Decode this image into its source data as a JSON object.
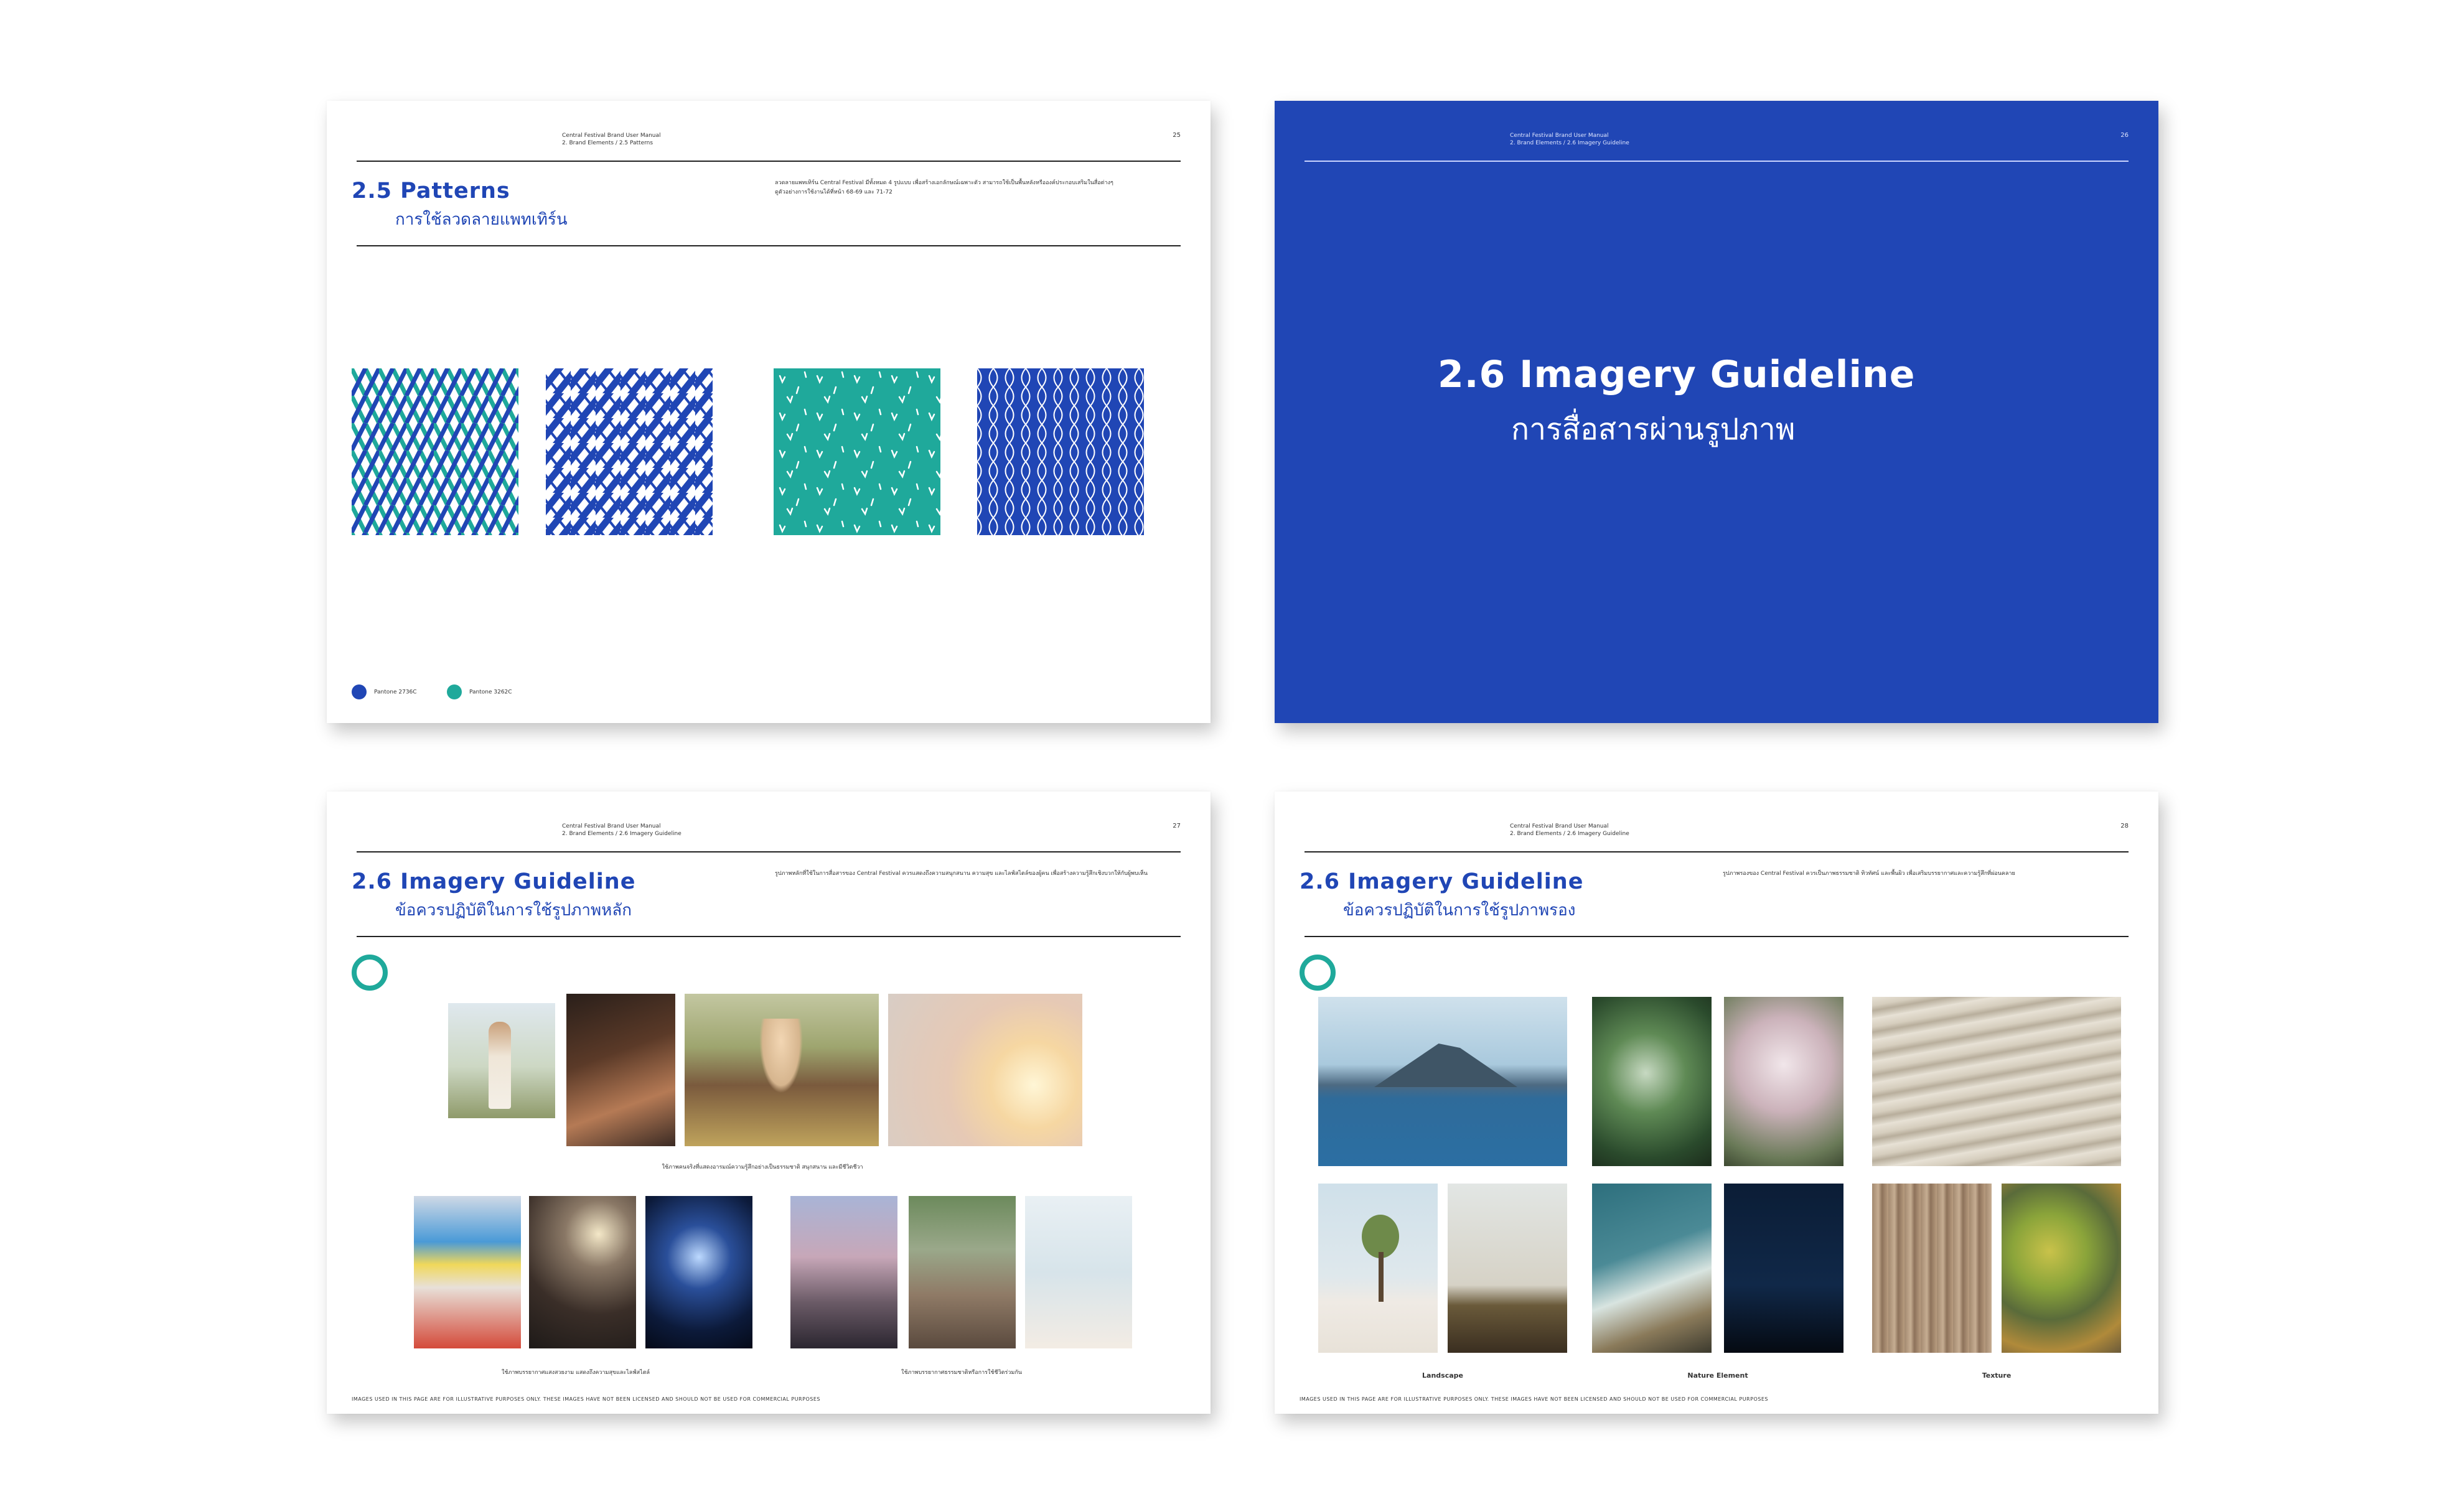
{
  "pages": {
    "p25": {
      "header": [
        "Central Festival Brand User Manual",
        "2. Brand Elements / 2.5 Patterns"
      ],
      "page_number": "25",
      "title": "2.5 Patterns",
      "subtitle": "การใช้ลวดลายแพทเทิร์น",
      "intro": "ลวดลายแพทเทิร์น Central Festival มีทั้งหมด 4 รูปแบบ เพื่อสร้างเอกลักษณ์เฉพาะตัว สามารถใช้เป็นพื้นหลังหรือองค์ประกอบเสริมในสื่อต่างๆ",
      "intro_ref": "ดูตัวอย่างการใช้งานได้ที่หน้า 68-69 และ 71-72",
      "legend": [
        {
          "label": "Pantone 2736C",
          "color": "#2046b5"
        },
        {
          "label": "Pantone 3262C",
          "color": "#1fa99b"
        }
      ]
    },
    "p26": {
      "header": [
        "Central Festival Brand User Manual",
        "2. Brand Elements / 2.6 Imagery Guideline"
      ],
      "page_number": "26",
      "title": "2.6 Imagery Guideline",
      "subtitle": "การสื่อสารผ่านรูปภาพ"
    },
    "p27": {
      "header": [
        "Central Festival Brand User Manual",
        "2. Brand Elements / 2.6 Imagery Guideline"
      ],
      "page_number": "27",
      "title": "2.6 Imagery Guideline",
      "subtitle": "ข้อควรปฏิบัติในการใช้รูปภาพหลัก",
      "intro": "รูปภาพหลักที่ใช้ในการสื่อสารของ Central Festival ควรแสดงถึงความสนุกสนาน ความสุข และไลฟ์สไตล์ของผู้คน เพื่อสร้างความรู้สึกเชิงบวกให้กับผู้พบเห็น",
      "caption1": "ใช้ภาพคนจริงที่แสดงอารมณ์ความรู้สึกอย่างเป็นธรรมชาติ สนุกสนาน และมีชีวิตชีวา",
      "caption2": "ใช้ภาพบรรยากาศแสงสวยงาม แสดงถึงความสุขและไลฟ์สไตล์",
      "caption3": "ใช้ภาพบรรยากาศธรรมชาติหรือการใช้ชีวิตร่วมกัน",
      "footer": "IMAGES USED IN THIS PAGE ARE FOR ILLUSTRATIVE PURPOSES ONLY. THESE IMAGES HAVE NOT BEEN LICENSED AND SHOULD NOT BE USED FOR COMMERCIAL PURPOSES"
    },
    "p28": {
      "header": [
        "Central Festival Brand User Manual",
        "2. Brand Elements / 2.6 Imagery Guideline"
      ],
      "page_number": "28",
      "title": "2.6 Imagery Guideline",
      "subtitle": "ข้อควรปฏิบัติในการใช้รูปภาพรอง",
      "intro": "รูปภาพรองของ Central Festival ควรเป็นภาพธรรมชาติ ทิวทัศน์ และพื้นผิว เพื่อเสริมบรรยากาศและความรู้สึกที่ผ่อนคลาย",
      "labels": [
        "Landscape",
        "Nature Element",
        "Texture"
      ],
      "footer": "IMAGES USED IN THIS PAGE ARE FOR ILLUSTRATIVE PURPOSES ONLY. THESE IMAGES HAVE NOT BEEN LICENSED AND SHOULD NOT BE USED FOR COMMERCIAL PURPOSES"
    }
  },
  "colors": {
    "brand_blue": "#2046b5",
    "brand_teal": "#1fa99b"
  },
  "patterns": [
    "teal-blue-lattice",
    "blue-weave",
    "teal-leaf",
    "blue-wave-lattice"
  ]
}
